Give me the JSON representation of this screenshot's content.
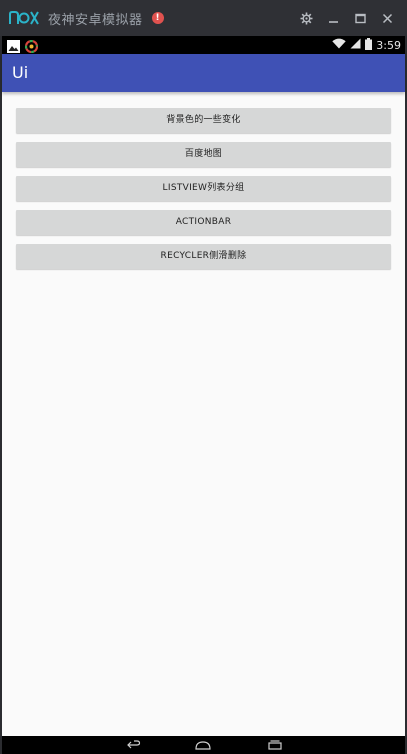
{
  "emulator": {
    "logo_text": "nox",
    "title": "夜神安卓模拟器",
    "alert_glyph": "!",
    "controls": {
      "settings_icon": "gear-icon",
      "minimize_icon": "minimize-icon",
      "maximize_icon": "maximize-icon",
      "close_icon": "close-icon"
    },
    "accent_color": "#2bb3c9"
  },
  "status_bar": {
    "time": "3:59",
    "left_icons": [
      "gallery-icon",
      "app-icon"
    ],
    "right_icons": [
      "wifi-icon",
      "signal-icon",
      "battery-icon"
    ]
  },
  "app_bar": {
    "title": "Ui",
    "color": "#3f51b5"
  },
  "buttons": [
    {
      "label": "背景色的一些变化"
    },
    {
      "label": "百度地图"
    },
    {
      "label": "LISTVIEW列表分组"
    },
    {
      "label": "ACTIONBAR"
    },
    {
      "label": "RECYCLER侧滑删除"
    }
  ],
  "nav_bar": {
    "back_icon": "back-icon",
    "home_icon": "home-icon",
    "recents_icon": "recents-icon"
  }
}
